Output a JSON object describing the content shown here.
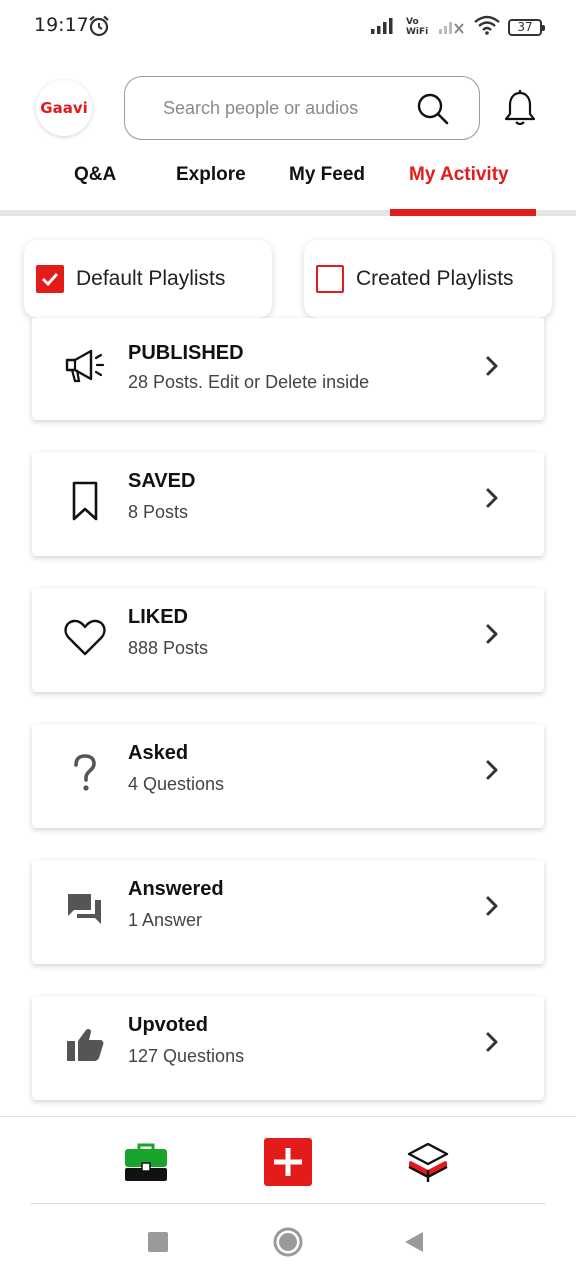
{
  "status_bar": {
    "time": "19:17",
    "network_label": "Vo WiFi",
    "battery": "37"
  },
  "header": {
    "logo_text": "Gaavi",
    "search_placeholder": "Search people or audios"
  },
  "tabs": [
    {
      "label": "Q&A",
      "active": false
    },
    {
      "label": "Explore",
      "active": false
    },
    {
      "label": "My Feed",
      "active": false
    },
    {
      "label": "My Activity",
      "active": true
    }
  ],
  "playlists": {
    "default": {
      "label": "Default Playlists",
      "checked": true
    },
    "created": {
      "label": "Created Playlists",
      "checked": false
    }
  },
  "activity": [
    {
      "title": "PUBLISHED",
      "subtitle": "28 Posts.  Edit or Delete inside",
      "icon": "megaphone-icon"
    },
    {
      "title": "SAVED",
      "subtitle": "8 Posts",
      "icon": "bookmark-icon"
    },
    {
      "title": "LIKED",
      "subtitle": "888 Posts",
      "icon": "heart-icon"
    },
    {
      "title": "Asked",
      "subtitle": "4 Questions",
      "icon": "question-icon"
    },
    {
      "title": "Answered",
      "subtitle": "1 Answer",
      "icon": "chat-bubbles-icon"
    },
    {
      "title": "Upvoted",
      "subtitle": "127 Questions",
      "icon": "thumbs-up-icon"
    }
  ],
  "bottom_nav": [
    {
      "icon": "briefcase-icon"
    },
    {
      "icon": "add-post-icon"
    },
    {
      "icon": "layers-icon"
    }
  ],
  "system_nav": [
    {
      "icon": "recents-square-icon"
    },
    {
      "icon": "home-circle-icon"
    },
    {
      "icon": "back-triangle-icon"
    }
  ],
  "colors": {
    "accent": "#e31b1b",
    "text": "#111111",
    "muted": "#8a8a8a"
  }
}
